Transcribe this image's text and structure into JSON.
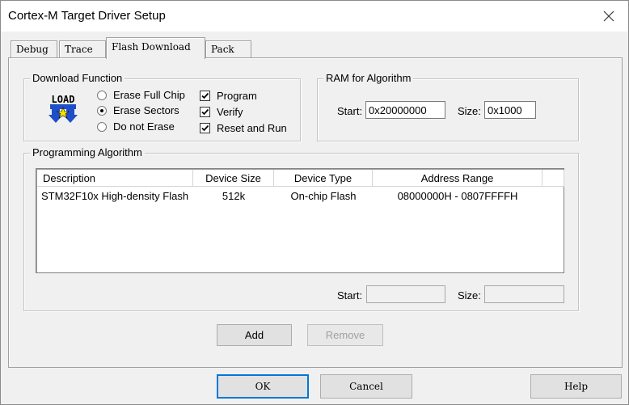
{
  "window": {
    "title": "Cortex-M Target Driver Setup"
  },
  "tabs": [
    {
      "label": "Debug",
      "active": false
    },
    {
      "label": "Trace",
      "active": false
    },
    {
      "label": "Flash Download",
      "active": true
    },
    {
      "label": "Pack",
      "active": false
    }
  ],
  "download_function": {
    "label": "Download Function",
    "icon_text": "LOAD",
    "radios": [
      {
        "label": "Erase Full Chip",
        "selected": false
      },
      {
        "label": "Erase Sectors",
        "selected": true
      },
      {
        "label": "Do not Erase",
        "selected": false
      }
    ],
    "checks": [
      {
        "label": "Program",
        "checked": true
      },
      {
        "label": "Verify",
        "checked": true
      },
      {
        "label": "Reset and Run",
        "checked": true
      }
    ]
  },
  "ram": {
    "label": "RAM for Algorithm",
    "start_label": "Start:",
    "start_value": "0x20000000",
    "size_label": "Size:",
    "size_value": "0x1000"
  },
  "programming": {
    "label": "Programming Algorithm",
    "columns": [
      "Description",
      "Device Size",
      "Device Type",
      "Address Range"
    ],
    "rows": [
      [
        "STM32F10x High-density Flash",
        "512k",
        "On-chip Flash",
        "08000000H - 0807FFFFH"
      ]
    ],
    "start_label": "Start:",
    "start_value": "",
    "size_label": "Size:",
    "size_value": ""
  },
  "buttons": {
    "add": "Add",
    "remove": "Remove",
    "ok": "OK",
    "cancel": "Cancel",
    "help": "Help"
  },
  "colors": {
    "accent": "#0078d7",
    "icon_blue": "#1f4fc8",
    "icon_yellow": "#f5e400"
  }
}
